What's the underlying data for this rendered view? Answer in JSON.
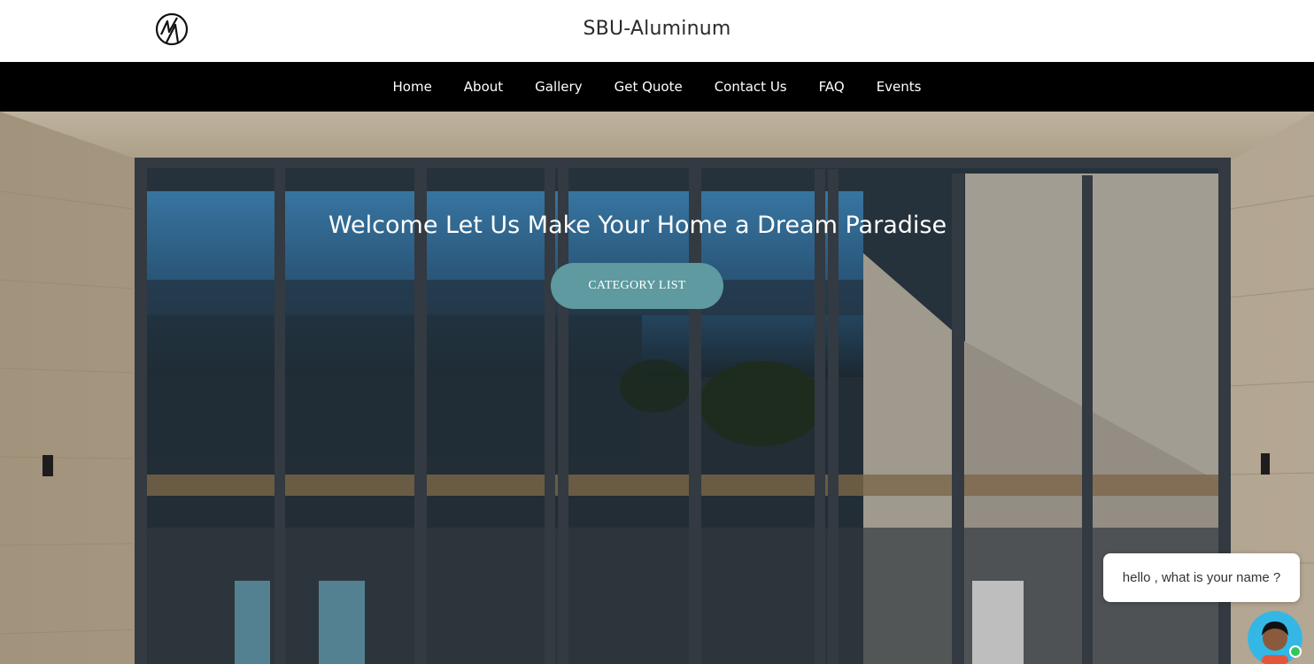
{
  "site": {
    "title": "SBU-Aluminum",
    "logo_icon": "logo-mark-icon"
  },
  "nav": {
    "items": [
      {
        "label": "Home"
      },
      {
        "label": "About"
      },
      {
        "label": "Gallery"
      },
      {
        "label": "Get Quote"
      },
      {
        "label": "Contact Us"
      },
      {
        "label": "FAQ"
      },
      {
        "label": "Events"
      }
    ]
  },
  "hero": {
    "title": "Welcome Let Us Make Your Home a Dream Paradise",
    "cta_label": "CATEGORY LIST",
    "cta_color": "#5e9a9f"
  },
  "chat": {
    "message": "hello , what is your name ?",
    "status_color": "#31c75a"
  }
}
